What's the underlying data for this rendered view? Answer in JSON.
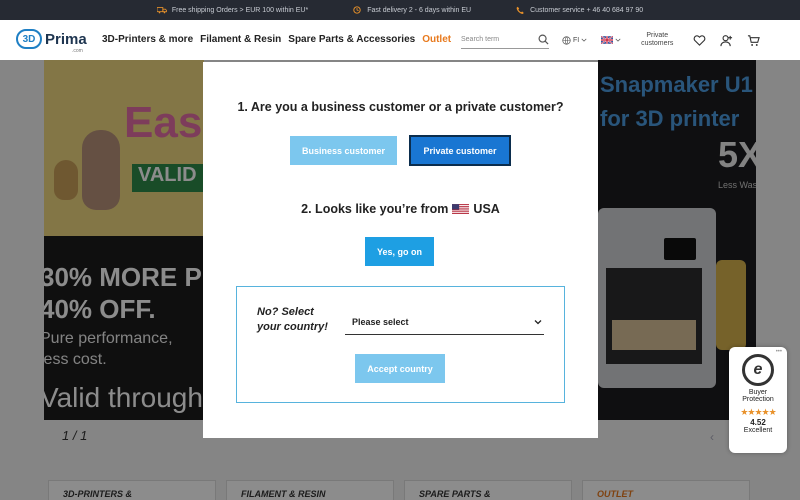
{
  "topbar": {
    "shipping": "Free shipping Orders > EUR 100 within EU*",
    "delivery": "Fast delivery 2 - 6 days within EU",
    "service": "Customer service + 46 40 684 97 90"
  },
  "header": {
    "logo_mark": "3D",
    "logo_text": "Prima",
    "logo_sub": ".com",
    "nav": [
      "3D-Printers & more",
      "Filament & Resin",
      "Spare Parts & Accessories",
      "Outlet"
    ],
    "search_placeholder": "Search term",
    "region": "FI",
    "private_customers": "Private customers"
  },
  "background": {
    "easter_word": "Eas",
    "easter_valid": "VALID",
    "promo_line1": "30% MORE P",
    "promo_line2": "40% OFF.",
    "promo_line3": "Pure performance,",
    "promo_line4": "less cost.",
    "promo_line5": "Valid through",
    "right_title1": "Snapmaker U1",
    "right_title2": "for 3D printer",
    "right_big": "5X",
    "right_small": "Less Waste",
    "pager": "1 / 1",
    "cards": [
      "3D-PRINTERS &",
      "FILAMENT & RESIN",
      "SPARE PARTS &",
      "OUTLET"
    ]
  },
  "badge": {
    "seal_letter": "e",
    "line1": "Buyer",
    "line2": "Protection",
    "stars": "★★★★★",
    "score": "4.52",
    "rating_label": "Excellent"
  },
  "modal": {
    "question1": "1. Are you a business customer or a private customer?",
    "business_label": "Business customer",
    "private_label": "Private customer",
    "question2_prefix": "2. Looks like you’re from",
    "country": "USA",
    "yes_label": "Yes, go on",
    "select_prompt": "No? Select your country!",
    "select_value": "Please select",
    "accept_label": "Accept country"
  },
  "colors": {
    "accent": "#1976d2",
    "light_accent": "#7cc7ee",
    "outlet": "#e87a1e",
    "topbar_bg": "#262a33"
  }
}
